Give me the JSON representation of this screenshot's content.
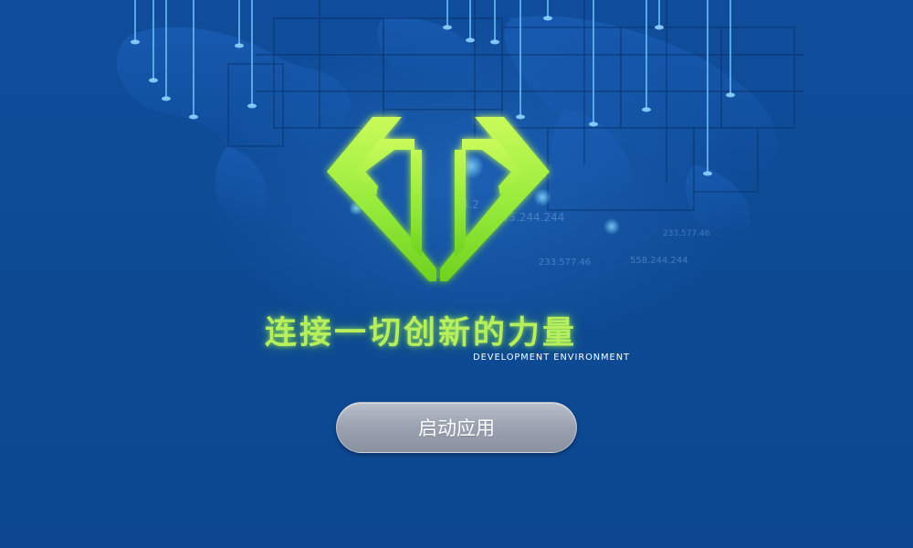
{
  "brand": {
    "logo_icon": "diamond-t-logo",
    "accent_color": "#8ee83a",
    "slogan": "连接一切创新的力量",
    "subtitle": "DEVELOPMENT   ENVIRONMENT"
  },
  "actions": {
    "launch_label": "启动应用"
  },
  "background": {
    "color": "#0d4a93",
    "decor_numbers": [
      "255.244.244",
      "24.2",
      "233.577.46",
      "558.244.244",
      "233.577.46"
    ]
  }
}
